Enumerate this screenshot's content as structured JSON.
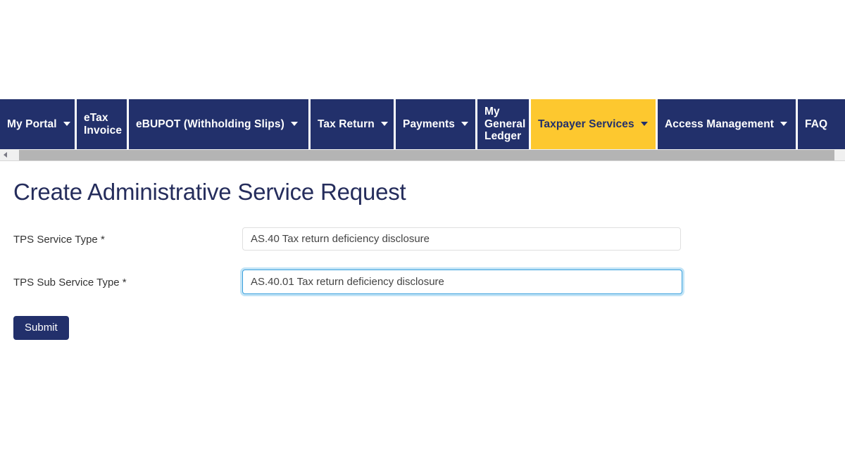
{
  "colors": {
    "nav_background": "#22306b",
    "nav_active_background": "#fdc82f",
    "nav_active_text": "#22306b",
    "title_text": "#252d5c",
    "button_background": "#22306b",
    "focus_border": "#3ba0dd",
    "scrollbar_thumb": "#b4b4b4"
  },
  "nav": {
    "items": [
      {
        "label": "My Portal",
        "has_caret": true,
        "active": false
      },
      {
        "label": "eTax\nInvoice",
        "has_caret": false,
        "active": false
      },
      {
        "label": "eBUPOT (Withholding Slips)",
        "has_caret": true,
        "active": false
      },
      {
        "label": "Tax Return",
        "has_caret": true,
        "active": false
      },
      {
        "label": "Payments",
        "has_caret": true,
        "active": false
      },
      {
        "label": "My\nGeneral\nLedger",
        "has_caret": false,
        "active": false
      },
      {
        "label": "Taxpayer Services",
        "has_caret": true,
        "active": true
      },
      {
        "label": "Access Management",
        "has_caret": true,
        "active": false
      },
      {
        "label": "FAQ",
        "has_caret": false,
        "active": false
      }
    ]
  },
  "scrollbar": {
    "left_arrow_icon": "triangle-left-icon",
    "orientation": "horizontal"
  },
  "main": {
    "title": "Create Administrative Service Request",
    "fields": [
      {
        "label": "TPS Service Type *",
        "value": "AS.40 Tax return deficiency disclosure",
        "placeholder": "",
        "focused": false
      },
      {
        "label": "TPS Sub Service Type *",
        "value": "AS.40.01 Tax return deficiency disclosure",
        "placeholder": "",
        "focused": true
      }
    ],
    "submit_label": "Submit"
  }
}
